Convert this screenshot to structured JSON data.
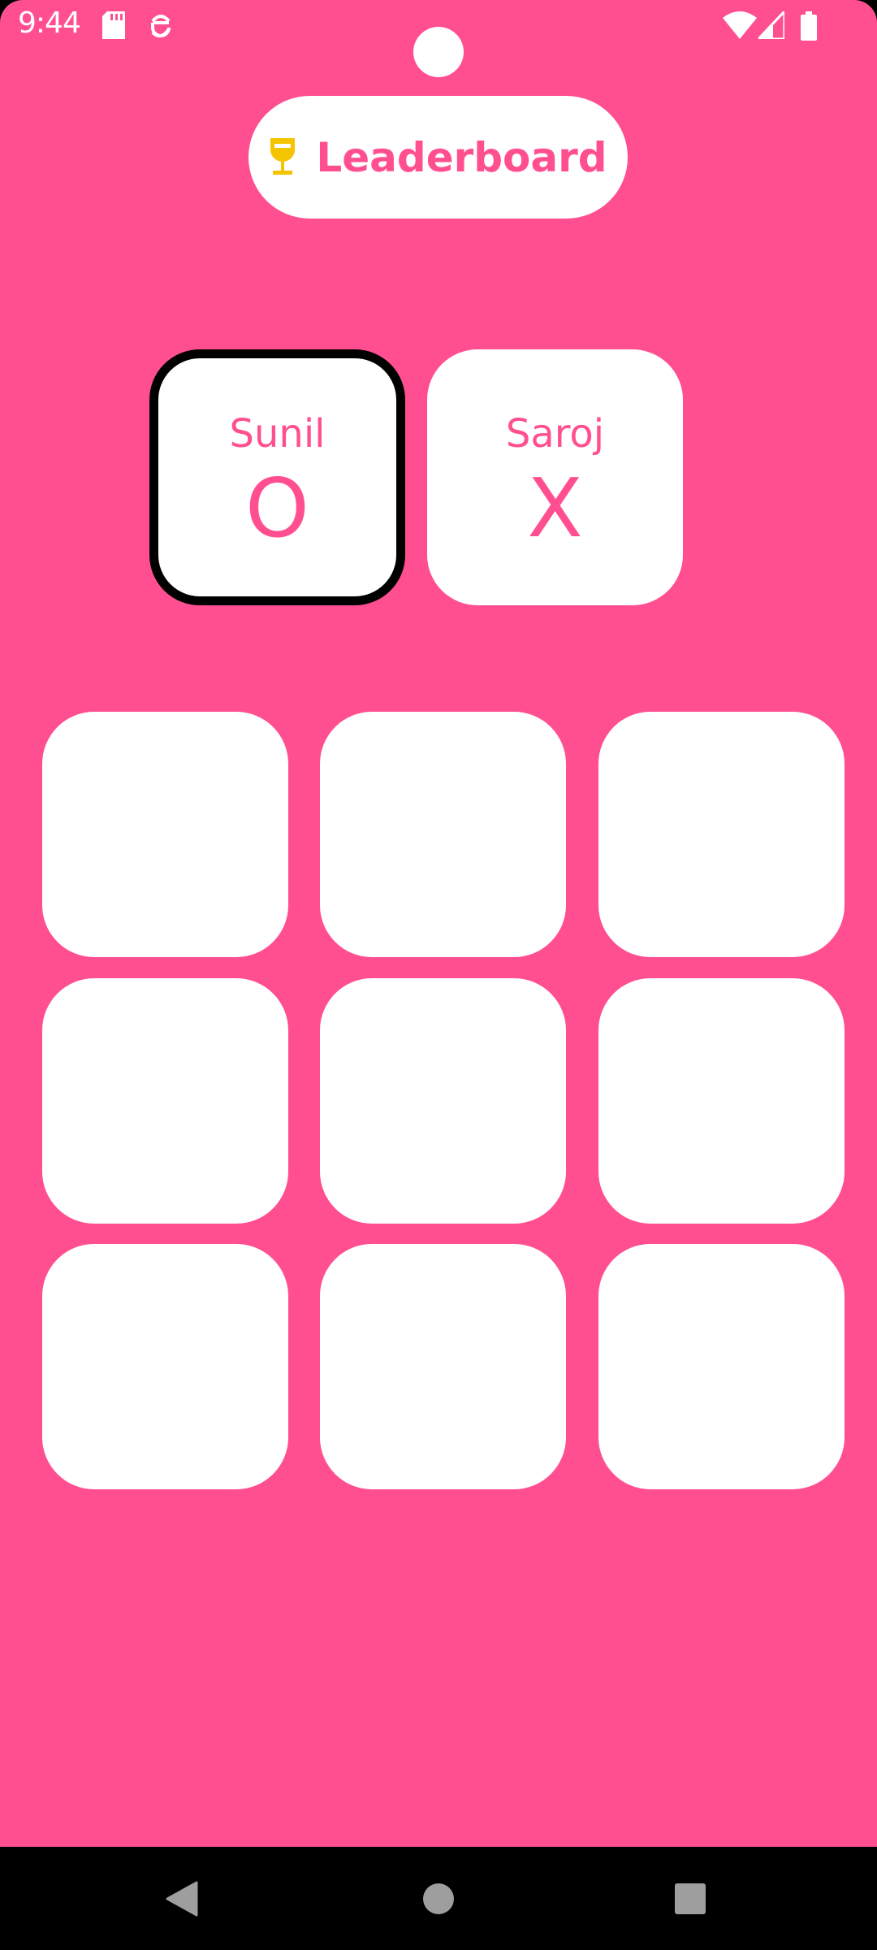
{
  "status_bar": {
    "time": "9:44",
    "icons_left": [
      "sd-card-icon",
      "android-debug-icon"
    ],
    "icons_right": [
      "wifi-icon",
      "cell-signal-icon",
      "battery-icon"
    ]
  },
  "leaderboard": {
    "label": "Leaderboard",
    "icon": "trophy-icon",
    "icon_color": "#F5C400"
  },
  "players": [
    {
      "name": "Sunil",
      "symbol": "O",
      "active": true
    },
    {
      "name": "Saroj",
      "symbol": "X",
      "active": false
    }
  ],
  "board": {
    "cells": [
      "",
      "",
      "",
      "",
      "",
      "",
      "",
      "",
      ""
    ]
  },
  "nav": [
    "back-button",
    "home-button",
    "recents-button"
  ],
  "colors": {
    "background": "#FF4F91",
    "accent": "#FF4F91",
    "card": "#FFFFFF"
  }
}
